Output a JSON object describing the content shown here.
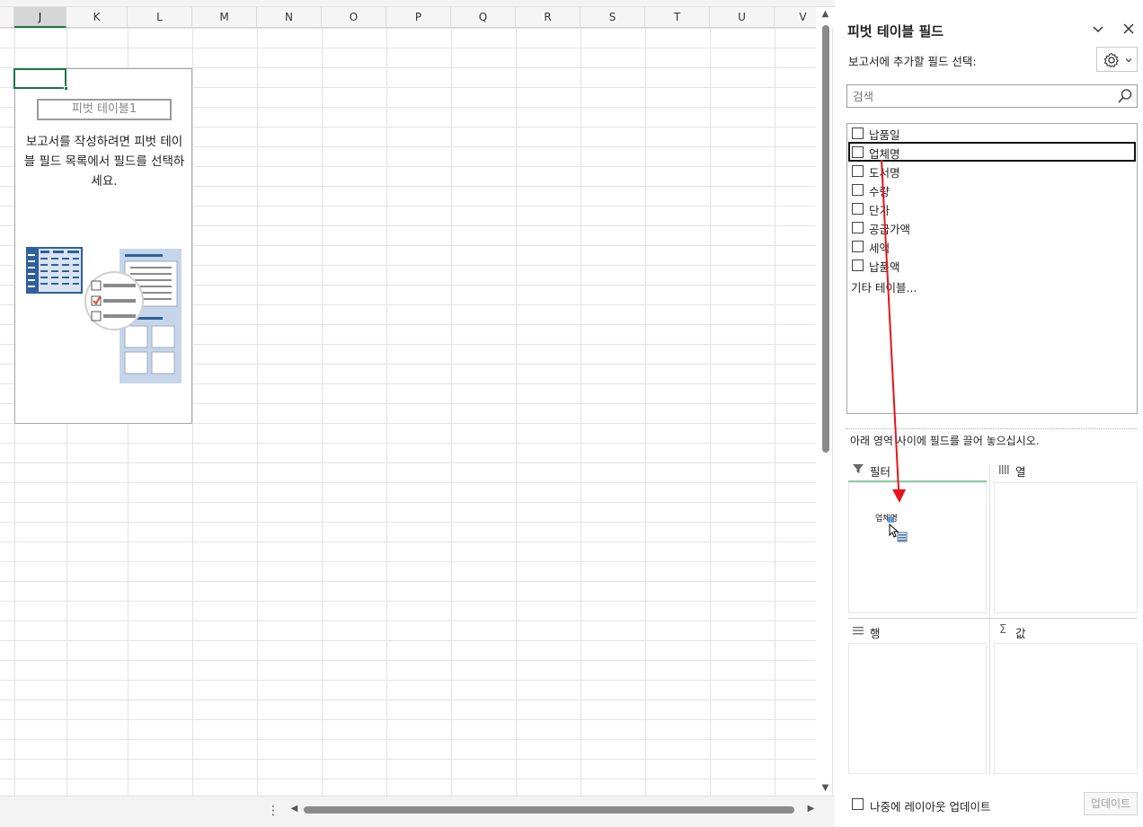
{
  "sheet": {
    "columns": [
      "J",
      "K",
      "L",
      "M",
      "N",
      "O",
      "P",
      "Q",
      "R",
      "S",
      "T",
      "U",
      "V"
    ],
    "selected_column": "J"
  },
  "pivot_placeholder": {
    "name": "피벗 테이블1",
    "instructions": "보고서를 작성하려면 피벗 테이블 필드 목록에서 필드를 선택하세요."
  },
  "pane": {
    "title": "피벗 테이블 필드",
    "subtitle": "보고서에 추가할 필드 선택:",
    "search_placeholder": "검색",
    "fields": [
      "납품일",
      "업체명",
      "도서명",
      "수량",
      "단가",
      "공급가액",
      "세액",
      "납품액"
    ],
    "more_tables": "기타 테이블...",
    "drag_hint": "아래 영역 사이에 필드를 끌어 놓으십시오.",
    "areas": {
      "filters": "필터",
      "columns": "열",
      "rows": "행",
      "values": "값"
    },
    "defer_label": "나중에 레이아웃 업데이트",
    "update_button": "업데이트"
  },
  "drag": {
    "ghost_text": "업체명"
  },
  "colors": {
    "excel_green": "#217346",
    "arrow_red": "#e8141b",
    "illus_blue": "#2f5f9c",
    "illus_light": "#c5d6ea"
  }
}
